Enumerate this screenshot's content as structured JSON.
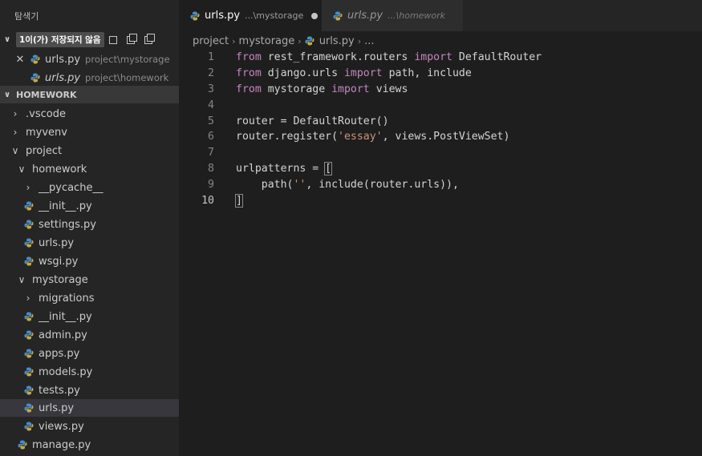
{
  "sidebar": {
    "title": "탐색기",
    "open_editors": {
      "badge": "1이(가) 저장되지 않음",
      "items": [
        {
          "name": "urls.py",
          "dir": "project\\mystorage"
        },
        {
          "name": "urls.py",
          "dir": "project\\homework"
        }
      ]
    },
    "folder": {
      "name": "HOMEWORK",
      "tree": [
        {
          "label": ".vscode",
          "expanded": false
        },
        {
          "label": "myvenv",
          "expanded": false
        },
        {
          "label": "project",
          "expanded": true
        },
        {
          "label": "homework",
          "expanded": true
        },
        {
          "label": "__pycache__",
          "expanded": false
        },
        {
          "label": "__init__.py"
        },
        {
          "label": "settings.py"
        },
        {
          "label": "urls.py"
        },
        {
          "label": "wsgi.py"
        },
        {
          "label": "mystorage",
          "expanded": true
        },
        {
          "label": "migrations",
          "expanded": false
        },
        {
          "label": "__init__.py"
        },
        {
          "label": "admin.py"
        },
        {
          "label": "apps.py"
        },
        {
          "label": "models.py"
        },
        {
          "label": "tests.py"
        },
        {
          "label": "urls.py"
        },
        {
          "label": "views.py"
        },
        {
          "label": "manage.py"
        }
      ]
    }
  },
  "tabs": [
    {
      "name": "urls.py",
      "desc": "...\\mystorage"
    },
    {
      "name": "urls.py",
      "desc": "...\\homework"
    }
  ],
  "breadcrumb": [
    "project",
    "mystorage",
    "urls.py",
    "..."
  ],
  "code": {
    "line_numbers": [
      "1",
      "2",
      "3",
      "4",
      "5",
      "6",
      "7",
      "8",
      "9",
      "10"
    ],
    "tokens": {
      "from": "from",
      "import": "import",
      "l1_mod": " rest_framework.routers ",
      "l1_name": " DefaultRouter",
      "l2_mod": " django.urls ",
      "l2_names": " path, include",
      "l3_mod": " mystorage ",
      "l3_name": " views",
      "l5": "router = DefaultRouter()",
      "l6_a": "router.register(",
      "l6_str": "'essay'",
      "l6_b": ", views.PostViewSet)",
      "l8": "urlpatterns = ",
      "bracket_open": "[",
      "l9_a": "    path(",
      "l9_str": "''",
      "l9_b": ", include(router.urls)),",
      "bracket_close": "]"
    }
  },
  "colors": {
    "keyword": "#c586c0",
    "string": "#ce9178",
    "python_icon_blue": "#4b8bbe",
    "python_icon_yellow": "#c5a843"
  }
}
